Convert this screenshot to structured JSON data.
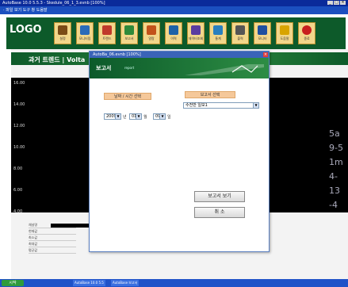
{
  "window": {
    "title": "AutoBase 10.0 5.5.3 - Skedule_06_1_3.evnb [100%]"
  },
  "menubar": {
    "text": "· 파일  보기  도구  창  도움말"
  },
  "toolbar": {
    "logo": "LOGO",
    "buttons": [
      {
        "label": "설정",
        "icon": "settings-icon",
        "color": "#7a4b16"
      },
      {
        "label": "모니터링",
        "icon": "monitor-icon",
        "color": "#2a6ab8"
      },
      {
        "label": "트렌드",
        "icon": "trend-icon",
        "color": "#c03a2b"
      },
      {
        "label": "보고서",
        "icon": "report-icon",
        "color": "#2f8a3a"
      },
      {
        "label": "알람",
        "icon": "alarm-icon",
        "color": "#c2521a"
      },
      {
        "label": "이력",
        "icon": "history-icon",
        "color": "#1d62a8"
      },
      {
        "label": "데이터조회",
        "icon": "data-icon",
        "color": "#5a3ca1"
      },
      {
        "label": "통계",
        "icon": "chart-icon",
        "color": "#2a7fbf"
      },
      {
        "label": "출력",
        "icon": "print-icon",
        "color": "#555555"
      },
      {
        "label": "모니터",
        "icon": "screen-icon",
        "color": "#1f4fa0"
      },
      {
        "label": "도움말",
        "icon": "help-icon",
        "color": "#d8a400"
      },
      {
        "label": "종료",
        "icon": "exit-icon",
        "color": "#c81e1e"
      }
    ]
  },
  "trend": {
    "title": "과거 트렌드 | Volta",
    "y_ticks": [
      "16.00",
      "14.00",
      "12.00",
      "10.00",
      "8.00",
      "6.00",
      "4.00"
    ],
    "legend_rows": [
      "채널명",
      "현재값",
      "최소값",
      "최대값",
      "평균값"
    ],
    "ghost_values": [
      "5a",
      "9-5",
      "1m",
      "4-13",
      "-4"
    ]
  },
  "dialog": {
    "title": "AutoBa_06.evnb [100%]",
    "banner_title": "보고서",
    "banner_sub": "report",
    "left_section": "날짜 / 시간 선택",
    "right_section": "보고서 선택",
    "report_selected": "수전반 일보1",
    "year": "2009",
    "year_unit": "년",
    "month": "01",
    "month_unit": "월",
    "day": "09",
    "day_unit": "일",
    "view_button": "보고서 보기",
    "cancel_button": "취   소"
  },
  "taskbar": {
    "start": "시작",
    "tasks": [
      "AutoBase 10.0 5.5",
      "AutoBase 보고서"
    ]
  }
}
